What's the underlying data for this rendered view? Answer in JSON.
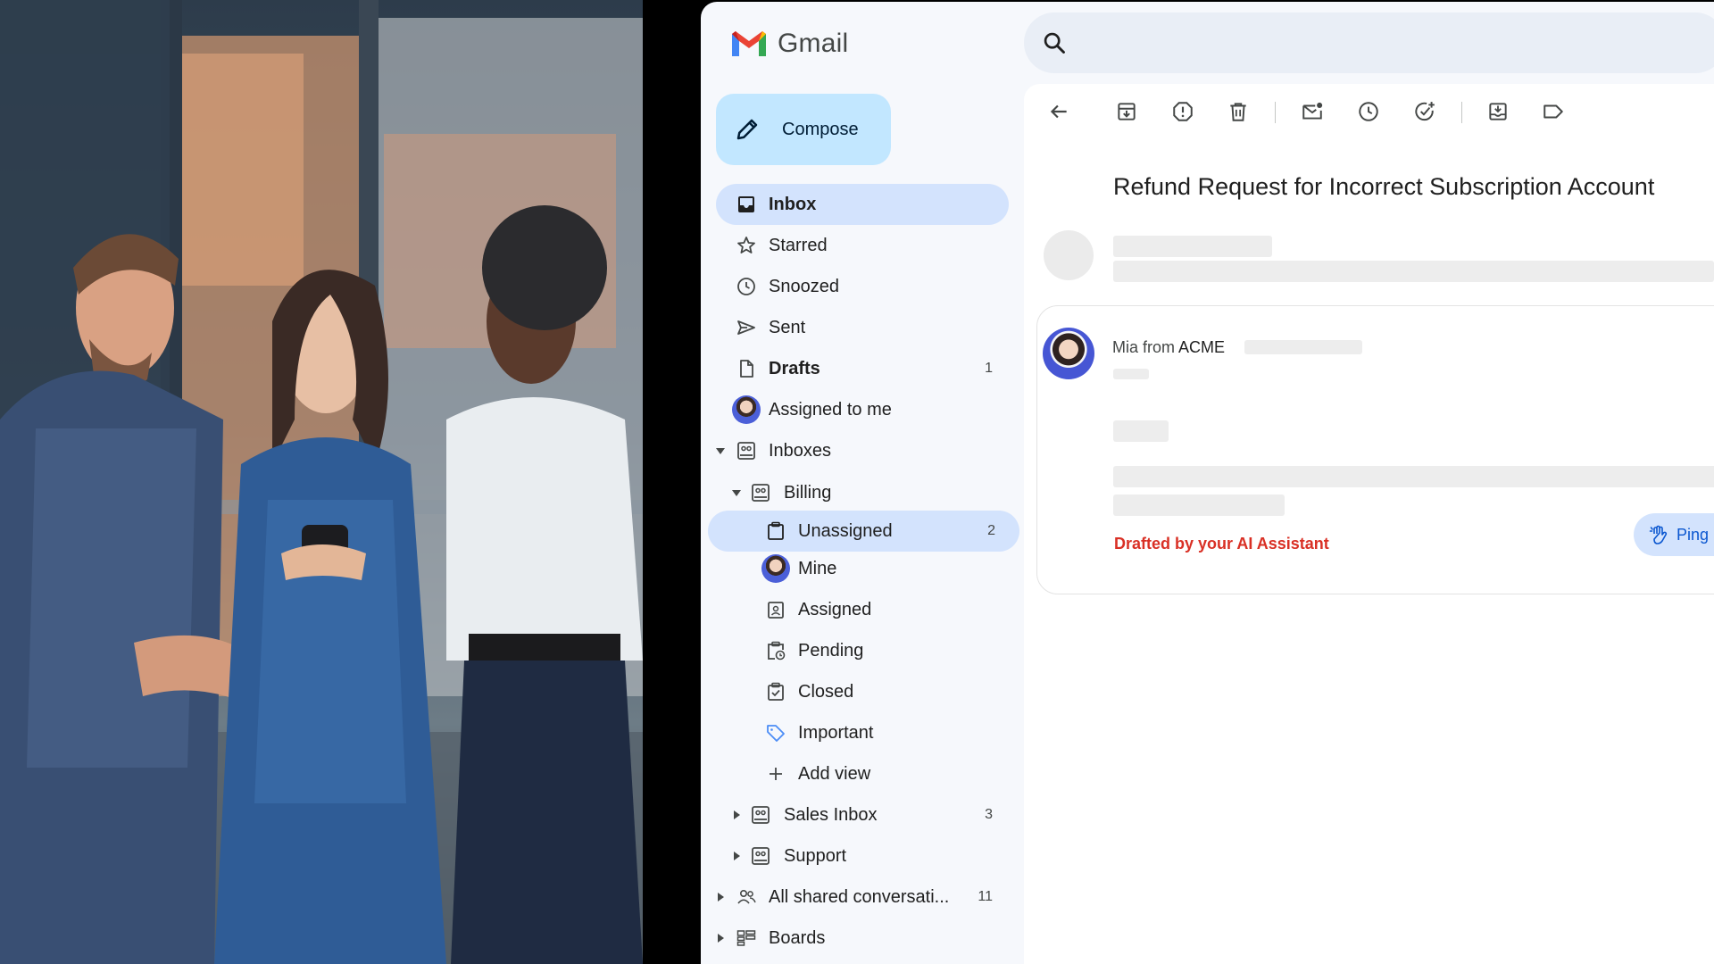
{
  "app": {
    "name": "Gmail"
  },
  "search": {
    "placeholder": ""
  },
  "compose": {
    "label": "Compose"
  },
  "nav": {
    "inbox": "Inbox",
    "starred": "Starred",
    "snoozed": "Snoozed",
    "sent": "Sent",
    "drafts": {
      "label": "Drafts",
      "count": "1"
    },
    "assigned_to_me": "Assigned to me",
    "inboxes": "Inboxes",
    "billing": "Billing",
    "unassigned": {
      "label": "Unassigned",
      "count": "2"
    },
    "mine": "Mine",
    "assigned": "Assigned",
    "pending": "Pending",
    "closed": "Closed",
    "important": "Important",
    "add_view": "Add view",
    "sales_inbox": {
      "label": "Sales Inbox",
      "count": "3"
    },
    "support": "Support",
    "all_shared": {
      "label": "All shared conversati...",
      "count": "11"
    },
    "boards": "Boards"
  },
  "message": {
    "subject": "Refund Request for Incorrect Subscription Account",
    "sender_prefix": "Mia from",
    "sender_org": "ACME",
    "drafted_note": "Drafted by your AI Assistant",
    "ping_label": "Ping"
  },
  "colors": {
    "accent": "#0b57d0",
    "active_nav": "#d3e3fd",
    "compose_bg": "#c2e7ff",
    "drafted": "#d93025"
  }
}
